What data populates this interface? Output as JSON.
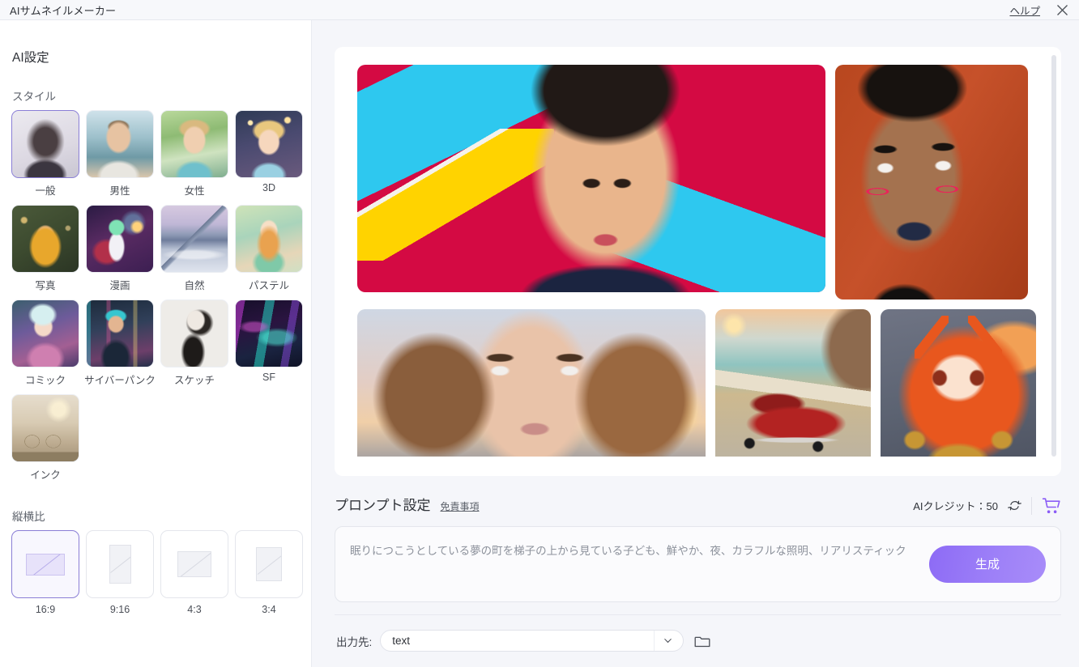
{
  "window": {
    "title": "AIサムネイルメーカー",
    "help_label": "ヘルプ",
    "close_icon": "close-icon"
  },
  "sidebar": {
    "title": "AI設定",
    "style_section_label": "スタイル",
    "styles": [
      {
        "label": "一般",
        "selected": true
      },
      {
        "label": "男性",
        "selected": false
      },
      {
        "label": "女性",
        "selected": false
      },
      {
        "label": "3D",
        "selected": false
      },
      {
        "label": "写真",
        "selected": false
      },
      {
        "label": "漫画",
        "selected": false
      },
      {
        "label": "自然",
        "selected": false
      },
      {
        "label": "パステル",
        "selected": false
      },
      {
        "label": "コミック",
        "selected": false
      },
      {
        "label": "サイバーパンク",
        "selected": false
      },
      {
        "label": "スケッチ",
        "selected": false
      },
      {
        "label": "SF",
        "selected": false
      },
      {
        "label": "インク",
        "selected": false
      }
    ],
    "ratio_section_label": "縦横比",
    "ratios": [
      {
        "label": "16:9",
        "selected": true
      },
      {
        "label": "9:16",
        "selected": false
      },
      {
        "label": "4:3",
        "selected": false
      },
      {
        "label": "3:4",
        "selected": false
      }
    ]
  },
  "gallery": {
    "items": [
      {
        "name": "man-portrait-geometric"
      },
      {
        "name": "woman-bold-makeup"
      },
      {
        "name": "woman-blue-eyes-sunset"
      },
      {
        "name": "red-convertible-beach"
      },
      {
        "name": "anime-catgirl-armor"
      }
    ]
  },
  "prompt": {
    "title": "プロンプト設定",
    "disclaimer_label": "免責事項",
    "credit_label": "AIクレジット：50",
    "refresh_icon": "refresh-icon",
    "cart_icon": "shopping-cart-icon",
    "placeholder": "眠りにつこうとしている夢の町を梯子の上から見ている子ども、鮮やか、夜、カラフルな照明、リアリスティック",
    "value": "",
    "generate_label": "生成"
  },
  "output": {
    "label": "出力先:",
    "value": "text",
    "caret_icon": "chevron-down-icon",
    "folder_icon": "folder-icon"
  },
  "colors": {
    "accent_purple": "#8B5CF6",
    "selected_border": "#8A7ED6",
    "panel_bg": "#F5F6FA",
    "card_bg": "#FFFFFF"
  }
}
